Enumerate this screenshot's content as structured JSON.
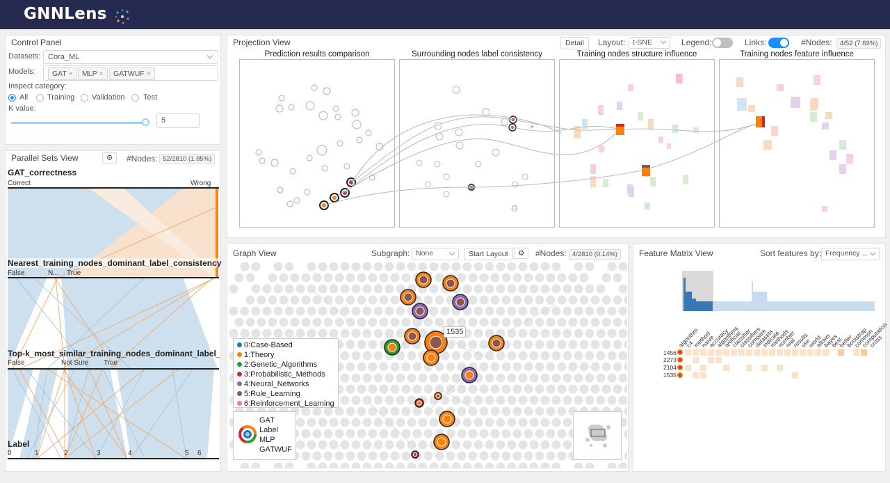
{
  "app": {
    "title": "GNNLens"
  },
  "control_panel": {
    "title": "Control Panel",
    "datasets_label": "Datasets:",
    "dataset_value": "Cora_ML",
    "models_label": "Models:",
    "models": [
      "GAT",
      "MLP",
      "GATWUF"
    ],
    "inspect_label": "Inspect category:",
    "categories": [
      "All",
      "Training",
      "Validation",
      "Test"
    ],
    "selected_category": "All",
    "k_label": "K value:",
    "k_value": "5",
    "slider_fraction": 1.0
  },
  "parallel_sets": {
    "title": "Parallel Sets View",
    "nodes_label": "#Nodes:",
    "nodes_value": "52/2810 (1.85%)",
    "axes": [
      {
        "name": "GAT_correctness",
        "cats": [
          "Correct",
          "Wrong"
        ]
      },
      {
        "name": "Nearest_training_nodes_dominant_label_consistency",
        "cats": [
          "False",
          "N...",
          "True"
        ]
      },
      {
        "name": "Top-k_most_similar_training_nodes_dominant_label_co",
        "cats": [
          "False",
          "Not Sure",
          "True"
        ]
      },
      {
        "name": "Label",
        "cats": [
          "0",
          "1",
          "2",
          "3",
          "4",
          "5",
          "6"
        ]
      }
    ]
  },
  "projection": {
    "title": "Projection View",
    "detail_button": "Detail",
    "layout_label": "Layout:",
    "layout_value": "t-SNE",
    "legend_label": "Legend:",
    "links_label": "Links:",
    "nodes_label": "#Nodes:",
    "nodes_value": "4/52 (7.69%)",
    "subviews": [
      "Prediction results comparison",
      "Surrounding nodes label consistency",
      "Training nodes structure influence",
      "Training nodes feature influence"
    ]
  },
  "graph": {
    "title": "Graph View",
    "subgraph_label": "Subgraph:",
    "subgraph_value": "None",
    "start_layout": "Start Layout",
    "nodes_label": "#Nodes:",
    "nodes_value": "4/2810 (0.14%)",
    "tooltip": "1535",
    "legend": [
      {
        "label": "0:Case-Based",
        "color": "#1f77b4"
      },
      {
        "label": "1:Theory",
        "color": "#ff7f0e"
      },
      {
        "label": "2:Genetic_Algorithms",
        "color": "#2ca02c"
      },
      {
        "label": "3:Probabilistic_Methods",
        "color": "#d62728"
      },
      {
        "label": "4:Neural_Networks",
        "color": "#9467bd"
      },
      {
        "label": "5:Rule_Learning",
        "color": "#8c564b"
      },
      {
        "label": "6:Reinforcement_Learning",
        "color": "#e377c2"
      }
    ],
    "glyph_legend": [
      "GAT",
      "Label",
      "MLP",
      "GATWUF"
    ]
  },
  "feature_matrix": {
    "title": "Feature Matrix View",
    "sort_label": "Sort features by:",
    "sort_value": "Frequency ...",
    "features": [
      "algorithm",
      "c4",
      "method",
      "naive",
      "accuracy",
      "algorithms",
      "artificial",
      "classifier",
      "classifiers",
      "compare",
      "datasets",
      "indicate",
      "methods",
      "number",
      "real",
      "results",
      "use",
      "world",
      "allows",
      "bayes",
      "best",
      "better",
      "bootstrap",
      "common",
      "computation",
      "cross"
    ],
    "rows": [
      "1456",
      "2273",
      "2104",
      "1535"
    ]
  }
}
